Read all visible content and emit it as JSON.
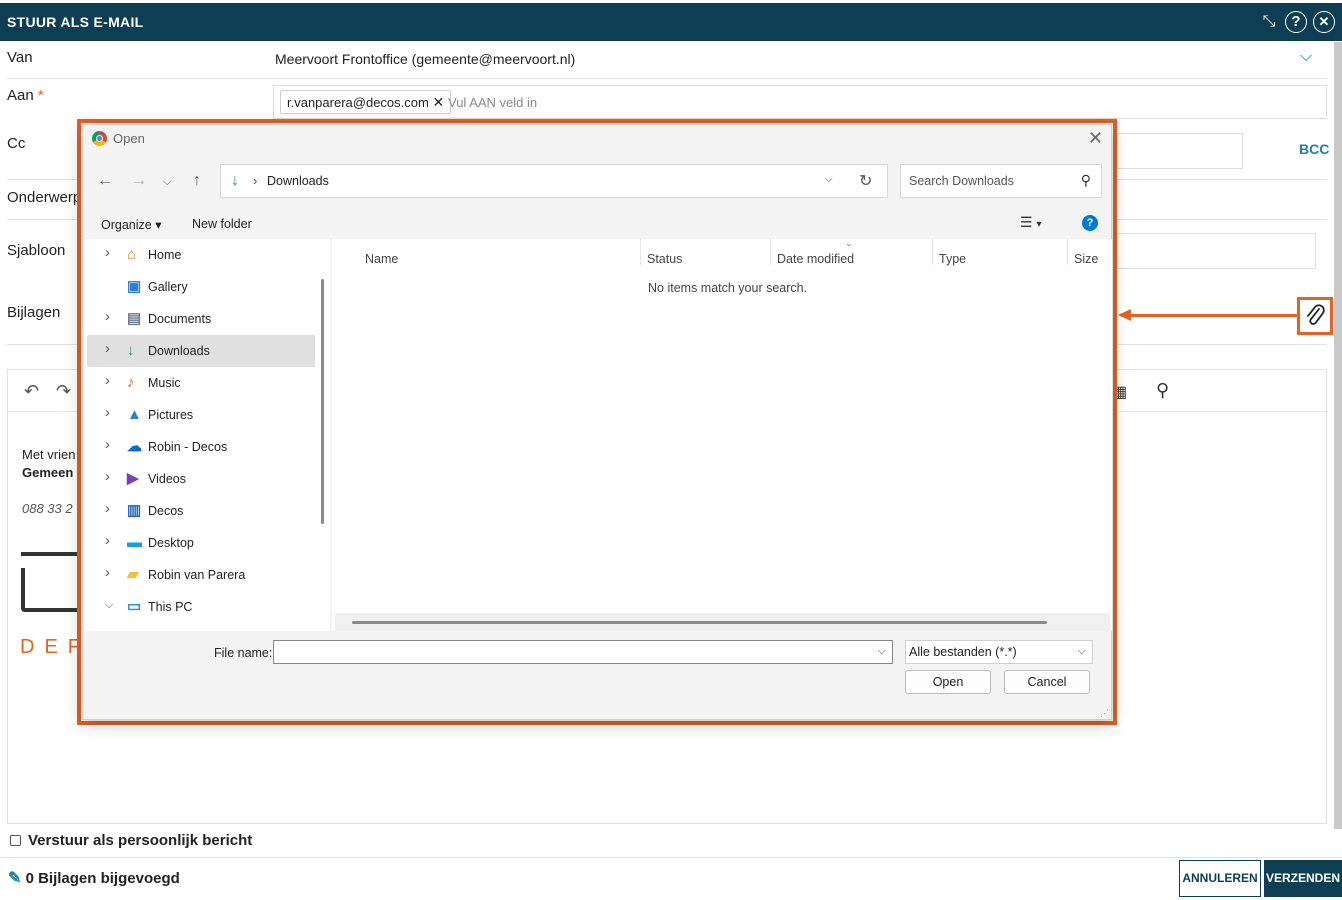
{
  "header": {
    "title": "STUUR ALS E-MAIL"
  },
  "form": {
    "van_label": "Van",
    "van_value": "Meervoort Frontoffice (gemeente@meervoort.nl)",
    "aan_label": "Aan",
    "aan_required": "*",
    "aan_chip": "r.vanparera@decos.com",
    "aan_placeholder": "Vul AAN veld in",
    "cc_label": "Cc",
    "bcc_label": "BCC",
    "onderwerp_label": "Onderwerp",
    "sjabloon_label": "Sjabloon",
    "bijlagen_label": "Bijlagen"
  },
  "editor": {
    "greeting_partial": "Met vrien",
    "org_partial": "Gemeen",
    "phone_partial": "088 33 2",
    "logo_partial": "DEF"
  },
  "persoonlijk_label": "Verstuur als persoonlijk bericht",
  "footer": {
    "attachments": "0 Bijlagen bijgevoegd",
    "cancel": "ANNULEREN",
    "send": "VERZENDEN"
  },
  "dialog": {
    "title": "Open",
    "address_folder": "Downloads",
    "search_placeholder": "Search Downloads",
    "organize": "Organize ▾",
    "new_folder": "New folder",
    "nav_items": [
      {
        "label": "Home",
        "icon": "home-icon",
        "chevron": true
      },
      {
        "label": "Gallery",
        "icon": "gallery-icon",
        "chevron": false
      },
      {
        "label": "Documents",
        "icon": "documents-icon",
        "chevron": true
      },
      {
        "label": "Downloads",
        "icon": "downloads-icon",
        "chevron": true,
        "selected": true
      },
      {
        "label": "Music",
        "icon": "music-icon",
        "chevron": true
      },
      {
        "label": "Pictures",
        "icon": "pictures-icon",
        "chevron": true
      },
      {
        "label": "Robin - Decos",
        "icon": "onedrive-icon",
        "chevron": true
      },
      {
        "label": "Videos",
        "icon": "videos-icon",
        "chevron": true
      },
      {
        "label": "Decos",
        "icon": "building-icon",
        "chevron": true
      },
      {
        "label": "Desktop",
        "icon": "desktop-icon",
        "chevron": true
      },
      {
        "label": "Robin van Parera",
        "icon": "folder-icon",
        "chevron": true
      },
      {
        "label": "This PC",
        "icon": "pc-icon",
        "chevron": true,
        "expanded": true
      }
    ],
    "columns": [
      "Name",
      "Status",
      "Date modified",
      "Type",
      "Size"
    ],
    "empty_message": "No items match your search.",
    "file_name_label": "File name:",
    "file_name_value": "",
    "file_type": "Alle bestanden (*.*)",
    "open_button": "Open",
    "cancel_button": "Cancel"
  },
  "colors": {
    "header_bg": "#0e3e54",
    "accent": "#e06424",
    "link": "#1f7fa8"
  }
}
